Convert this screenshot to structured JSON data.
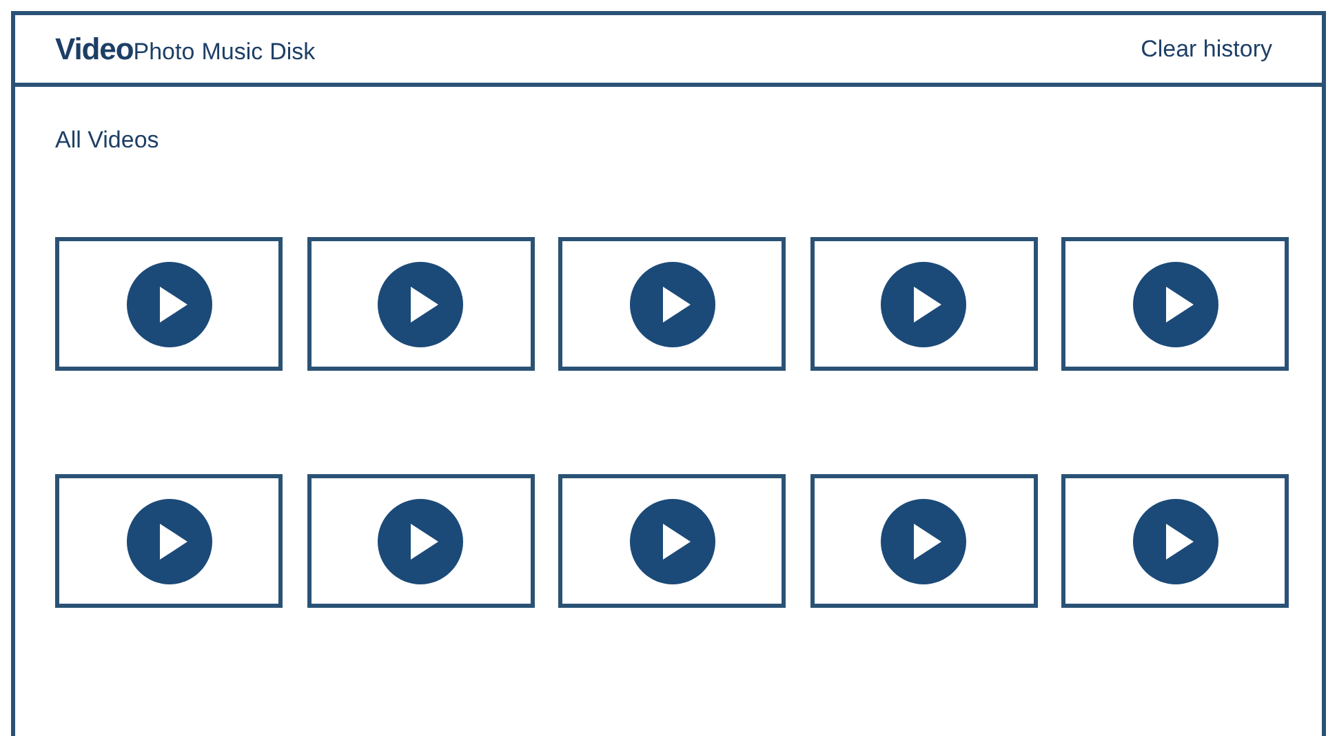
{
  "tabs": [
    {
      "label": "Video",
      "selected": true
    },
    {
      "label": "Photo",
      "selected": false
    },
    {
      "label": "Music",
      "selected": false
    },
    {
      "label": "Disk",
      "selected": false
    }
  ],
  "clear_history": "Clear history",
  "section_title": "All Videos",
  "thumbnails": [
    {
      "kind": "video"
    },
    {
      "kind": "video"
    },
    {
      "kind": "video"
    },
    {
      "kind": "video"
    },
    {
      "kind": "video"
    },
    {
      "kind": "video"
    },
    {
      "kind": "video"
    },
    {
      "kind": "video"
    },
    {
      "kind": "video"
    },
    {
      "kind": "video"
    }
  ]
}
